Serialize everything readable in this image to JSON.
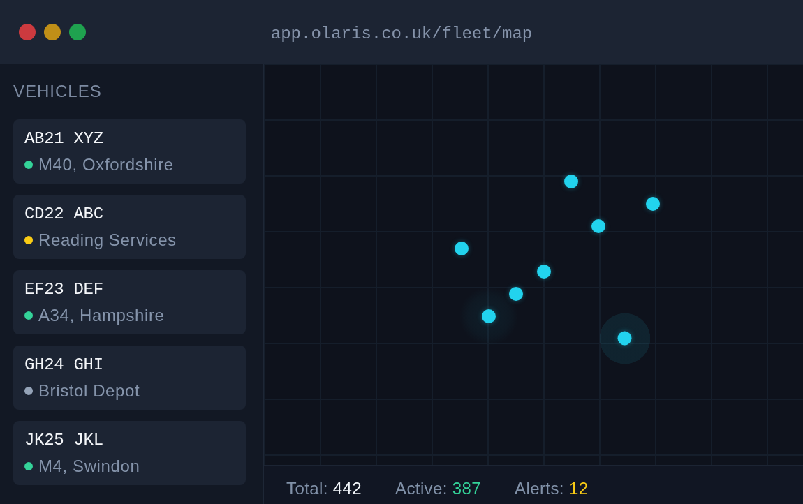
{
  "window": {
    "url": "app.olaris.co.uk/fleet/map"
  },
  "sidebar": {
    "title": "VEHICLES",
    "vehicles": [
      {
        "plate": "AB21 XYZ",
        "location": "M40, Oxfordshire",
        "color": "#34d399"
      },
      {
        "plate": "CD22 ABC",
        "location": "Reading Services",
        "color": "#facc15"
      },
      {
        "plate": "EF23 DEF",
        "location": "A34, Hampshire",
        "color": "#34d399"
      },
      {
        "plate": "GH24 GHI",
        "location": "Bristol Depot",
        "color": "#94a3b8"
      },
      {
        "plate": "JK25 JKL",
        "location": "M4, Swindon",
        "color": "#34d399"
      }
    ]
  },
  "map": {
    "markers": [
      {
        "selected": false,
        "pulsing": false
      },
      {
        "selected": false,
        "pulsing": true
      },
      {
        "selected": false,
        "pulsing": false
      },
      {
        "selected": false,
        "pulsing": false
      },
      {
        "selected": false,
        "pulsing": false
      },
      {
        "selected": false,
        "pulsing": false
      },
      {
        "selected": true,
        "pulsing": false
      },
      {
        "selected": false,
        "pulsing": false
      }
    ]
  },
  "status_bar": {
    "stats": [
      {
        "label": "Total:",
        "value": "442",
        "color": "#f1f5f9"
      },
      {
        "label": "Active:",
        "value": "387",
        "color": "#34d399"
      },
      {
        "label": "Alerts:",
        "value": "12",
        "color": "#facc15"
      }
    ]
  }
}
